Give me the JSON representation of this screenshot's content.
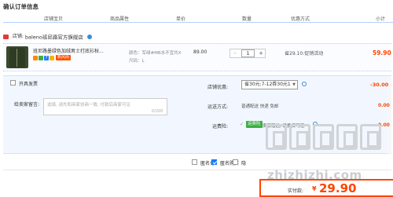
{
  "page": {
    "title": "确认订单信息"
  },
  "table_headers": [
    "店铺宝贝",
    "商品属性",
    "单价",
    "数量",
    "优惠方式",
    "小计"
  ],
  "shop": {
    "label": "店铺:",
    "name": "baleno班尼路官方旗舰店",
    "icon": "store-icon"
  },
  "item": {
    "name": "班尼路墨绿色加绒男士打底衫秋...",
    "color_attr": "颜色：军绿#MB水不宜共X",
    "size_attr": "尺码：L",
    "price": "89.00",
    "quantity": "1",
    "promo": "省29.10:促销活动",
    "subtotal": "59.90",
    "badges": [
      "7",
      "新风尚"
    ],
    "colors": {
      "accent": "#ff4400",
      "link": "#3c8bd9"
    }
  },
  "options": {
    "invoice_label": "开具发票",
    "message_label": "给卖家留言:",
    "message_placeholder": "选填, 请先和商家协商一致, 付款后商家可见",
    "message_count": "0/200",
    "discount_label": "店铺优惠:",
    "discount_value": "省30元:7-12券30元1",
    "discount_amount": "-30.00",
    "shipping_label": "运送方式:",
    "shipping_value": "普通配送 快递 免邮",
    "shipping_amount": "0.00",
    "service_label": "运费险:",
    "service_badge": "运费险",
    "service_text": "卖家赠送, 退换货可赔",
    "service_amount": "0.00"
  },
  "bottom": {
    "anon_label": "匿名付",
    "pay_label": "匿名购买",
    "hide_label": "隐",
    "total_label": "实付款:",
    "total_currency": "¥",
    "total_amount": "29.90"
  },
  "watermark": {
    "text": "zhizhizhi.com"
  }
}
